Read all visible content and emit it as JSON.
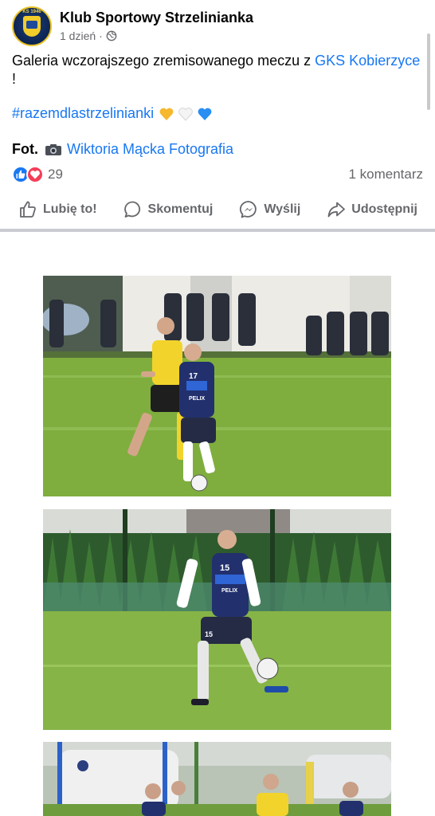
{
  "post": {
    "page_name": "Klub Sportowy Strzelinianka",
    "time": "1 dzień",
    "separator": "·",
    "avatar_text": "KS 1946",
    "text_prefix": "Galeria wczorajszego zremisowanego meczu z ",
    "text_link": "GKS Kobierzyce",
    "text_suffix": " !",
    "hashtag": "#razemdlastrzelinianki",
    "hearts": [
      "yellow-heart-icon",
      "white-heart-icon",
      "blue-heart-icon"
    ],
    "credit_label": "Fot.",
    "credit_name": "Wiktoria Mącka Fotografia"
  },
  "reactions": {
    "count": "29",
    "types": [
      "like",
      "love"
    ],
    "comments": "1 komentarz"
  },
  "actions": {
    "like": "Lubię to!",
    "comment": "Skomentuj",
    "send": "Wyślij",
    "share": "Udostępnij"
  },
  "photos": {
    "photo_1": {
      "jersey_blue": "17",
      "sponsor": "PELIX"
    },
    "photo_2": {
      "jersey_blue": "15",
      "sponsor": "PELIX",
      "shorts": "15"
    },
    "photo_3": {}
  },
  "colors": {
    "link": "#1877f2",
    "secondary_text": "#65676b",
    "like": "#1877f2",
    "love": "#f33e58",
    "blue_kit": "#22306e",
    "yellow_kit": "#f2d32b",
    "grass": "#76a53a"
  }
}
